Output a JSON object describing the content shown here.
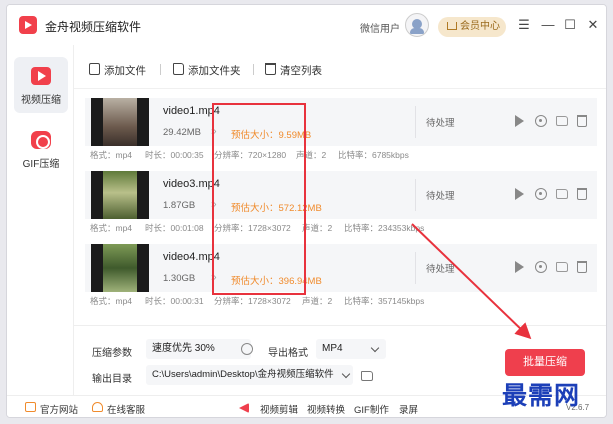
{
  "app": {
    "title": "金舟视频压缩软件",
    "user_name": "微信用户",
    "vip_label": "会员中心"
  },
  "window_controls": [
    "☰",
    "—",
    "☐",
    "✕"
  ],
  "sidebar": {
    "items": [
      {
        "label": "视频压缩",
        "active": true,
        "icon": "video-play-icon"
      },
      {
        "label": "GIF压缩",
        "active": false,
        "icon": "gif-icon"
      }
    ]
  },
  "toolbar": {
    "add_file": "添加文件",
    "add_folder": "添加文件夹",
    "clear_list": "清空列表"
  },
  "files": [
    {
      "name": "video1.mp4",
      "size": "29.42MB",
      "estimate": "预估大小：9.59MB",
      "status": "待处理",
      "meta": {
        "format": "格式：mp4",
        "duration": "时长：00:00:35",
        "resolution": "分辨率：720×1280",
        "channels": "声道：2",
        "bitrate": "比特率：6785kbps"
      }
    },
    {
      "name": "video3.mp4",
      "size": "1.87GB",
      "estimate": "预估大小：572.12MB",
      "status": "待处理",
      "meta": {
        "format": "格式：mp4",
        "duration": "时长：00:01:08",
        "resolution": "分辨率：1728×3072",
        "channels": "声道：2",
        "bitrate": "比特率：234353kbps"
      }
    },
    {
      "name": "video4.mp4",
      "size": "1.30GB",
      "estimate": "预估大小：396.94MB",
      "status": "待处理",
      "meta": {
        "format": "格式：mp4",
        "duration": "时长：00:00:31",
        "resolution": "分辨率：1728×3072",
        "channels": "声道：2",
        "bitrate": "比特率：357145kbps"
      }
    }
  ],
  "settings": {
    "compress_label": "压缩参数",
    "compress_value": "速度优先 30%",
    "export_format_label": "导出格式",
    "export_format_value": "MP4",
    "output_label": "输出目录",
    "output_value": "C:\\Users\\admin\\Desktop\\金舟视频压缩软件",
    "batch_button": "批量压缩"
  },
  "footer": {
    "official_site": "官方网站",
    "online_service": "在线客服",
    "links": [
      "视频剪辑",
      "视频转换",
      "GIF制作",
      "录屏"
    ],
    "version": "V2.6.7"
  },
  "watermark": "最需网",
  "colors": {
    "accent": "#ef3f4d",
    "estimate": "#f08b2c",
    "annotation": "#e8323d",
    "watermark": "#1c3fb8"
  }
}
